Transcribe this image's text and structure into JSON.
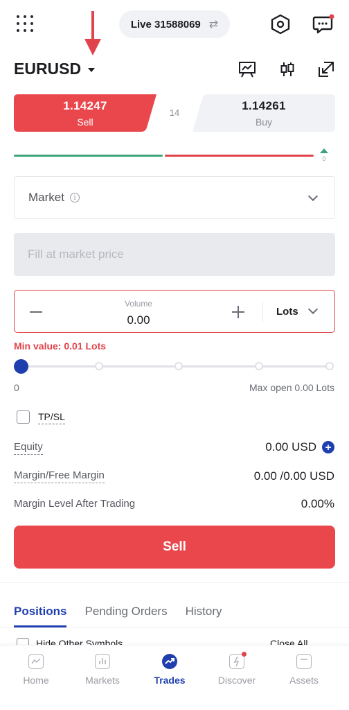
{
  "header": {
    "account_label": "Live 31588069",
    "symbol": "EURUSD"
  },
  "quote": {
    "sell_price": "1.14247",
    "sell_label": "Sell",
    "buy_price": "1.14261",
    "buy_label": "Buy",
    "spread": "14",
    "sentiment_value": "0"
  },
  "order": {
    "type": "Market",
    "price_placeholder": "Fill at market price",
    "volume_label": "Volume",
    "volume_value": "0.00",
    "volume_unit": "Lots",
    "min_value_warning": "Min value: 0.01 Lots",
    "slider_min": "0",
    "slider_max": "Max open 0.00 Lots",
    "tpsl_label": "TP/SL"
  },
  "account_stats": {
    "equity_label": "Equity",
    "equity_value": "0.00 USD",
    "margin_label": "Margin/Free Margin",
    "margin_value": "0.00 /0.00 USD",
    "margin_level_label": "Margin Level After Trading",
    "margin_level_value": "0.00%"
  },
  "action": {
    "sell_button": "Sell"
  },
  "tabs": {
    "positions": "Positions",
    "pending": "Pending Orders",
    "history": "History"
  },
  "filters": {
    "hide_other": "Hide Other Symbols",
    "close_all": "Close All"
  },
  "bottom_nav": {
    "home": "Home",
    "markets": "Markets",
    "trades": "Trades",
    "discover": "Discover",
    "assets": "Assets"
  },
  "colors": {
    "sell_red": "#e9474c",
    "brand_blue": "#1f3fae",
    "buy_gray": "#f1f2f5",
    "sentiment_green": "#3aa57a"
  }
}
